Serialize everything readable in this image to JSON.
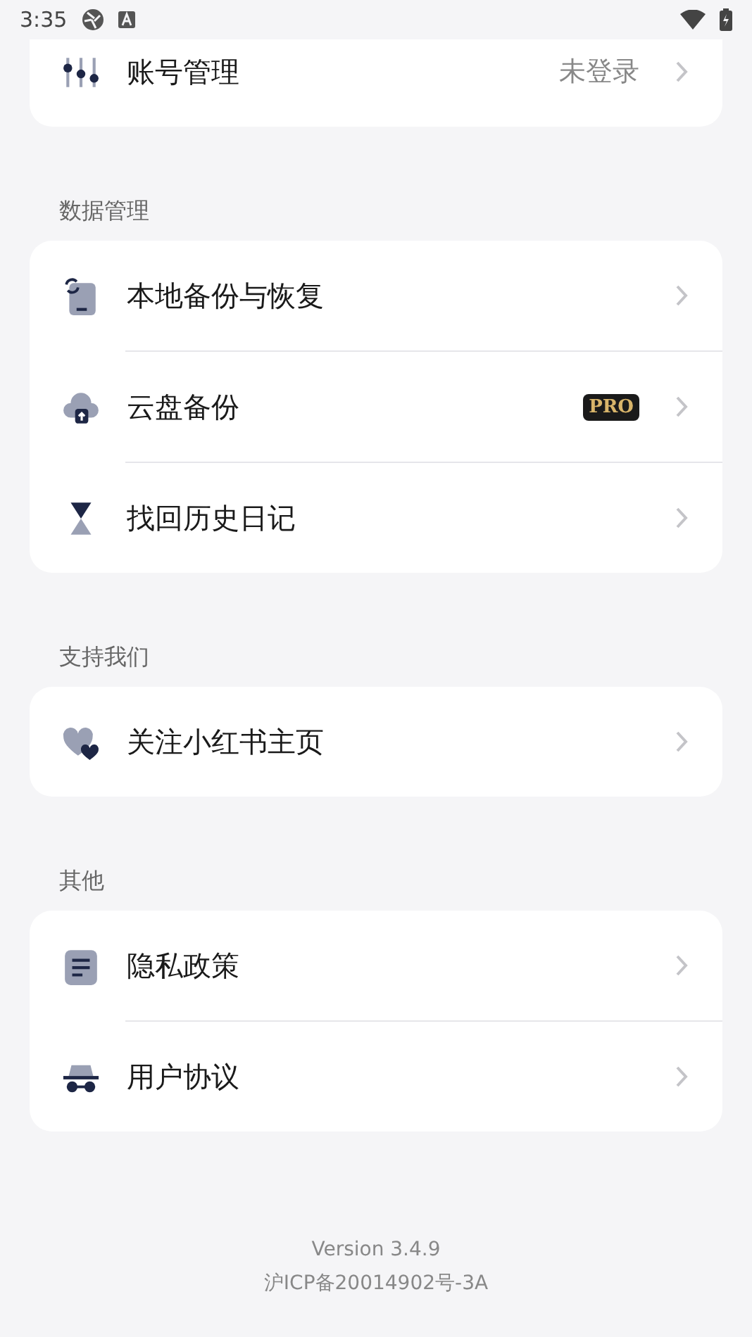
{
  "status_bar": {
    "time": "3:35"
  },
  "sections": [
    {
      "items": [
        {
          "label": "账号管理",
          "value": "未登录"
        }
      ]
    },
    {
      "title": "数据管理",
      "items": [
        {
          "label": "本地备份与恢复"
        },
        {
          "label": "云盘备份",
          "badge": "PRO"
        },
        {
          "label": "找回历史日记"
        }
      ]
    },
    {
      "title": "支持我们",
      "items": [
        {
          "label": "关注小红书主页"
        }
      ]
    },
    {
      "title": "其他",
      "items": [
        {
          "label": "隐私政策"
        },
        {
          "label": "用户协议"
        }
      ]
    }
  ],
  "footer": {
    "version": "Version 3.4.9",
    "icp": "沪ICP备20014902号-3A"
  }
}
